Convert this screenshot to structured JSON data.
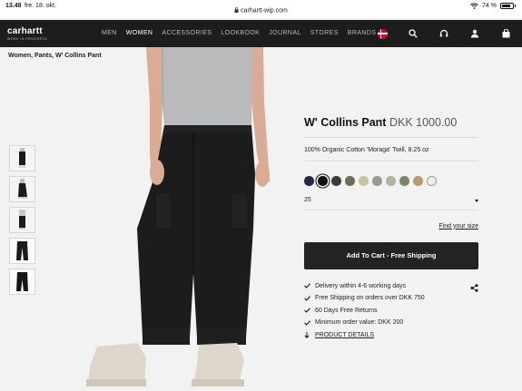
{
  "status_bar": {
    "time": "13.48",
    "date": "fre. 18. okt.",
    "url": "carhartt-wip.com",
    "battery": "74 %"
  },
  "nav": {
    "logo": "carhartt",
    "logo_sub": "WORK IN PROGRESS",
    "menu": [
      "MEN",
      "WOMEN",
      "ACCESSORIES",
      "LOOKBOOK",
      "JOURNAL",
      "STORES",
      "BRANDS"
    ],
    "active": "WOMEN",
    "icons": [
      "danish-flag-icon",
      "search-icon",
      "headset-icon",
      "user-icon",
      "shopping-bag-icon"
    ]
  },
  "breadcrumb": "Women, Pants, W' Collins Pant",
  "product": {
    "name": "W' Collins Pant",
    "price": "DKK 1000.00",
    "material": "100% Organic Cotton 'Moraga' Twill, 8.25 oz",
    "swatches": [
      {
        "color": "#1f2a44"
      },
      {
        "color": "#111111",
        "selected": true
      },
      {
        "color": "#3a3a2e"
      },
      {
        "color": "#6b6e56"
      },
      {
        "color": "#c7c39a"
      },
      {
        "color": "#9a9a93"
      },
      {
        "color": "#b7b1a4"
      },
      {
        "color": "#7d8467"
      },
      {
        "color": "#b89c6d"
      },
      {
        "color": "#eeeee8"
      }
    ],
    "selected_size": "25",
    "find_size": "Find your size",
    "cta": "Add To Cart - Free Shipping",
    "features": [
      {
        "icon": "check-icon",
        "text": "Delivery within 4-6 working days"
      },
      {
        "icon": "check-icon",
        "text": "Free Shipping on orders over DKK 750"
      },
      {
        "icon": "check-icon",
        "text": "60 Days Free Returns"
      },
      {
        "icon": "check-icon",
        "text": "Minimum order value: DKK 200"
      },
      {
        "icon": "arrow-down-icon",
        "text": "PRODUCT DETAILS"
      }
    ]
  }
}
